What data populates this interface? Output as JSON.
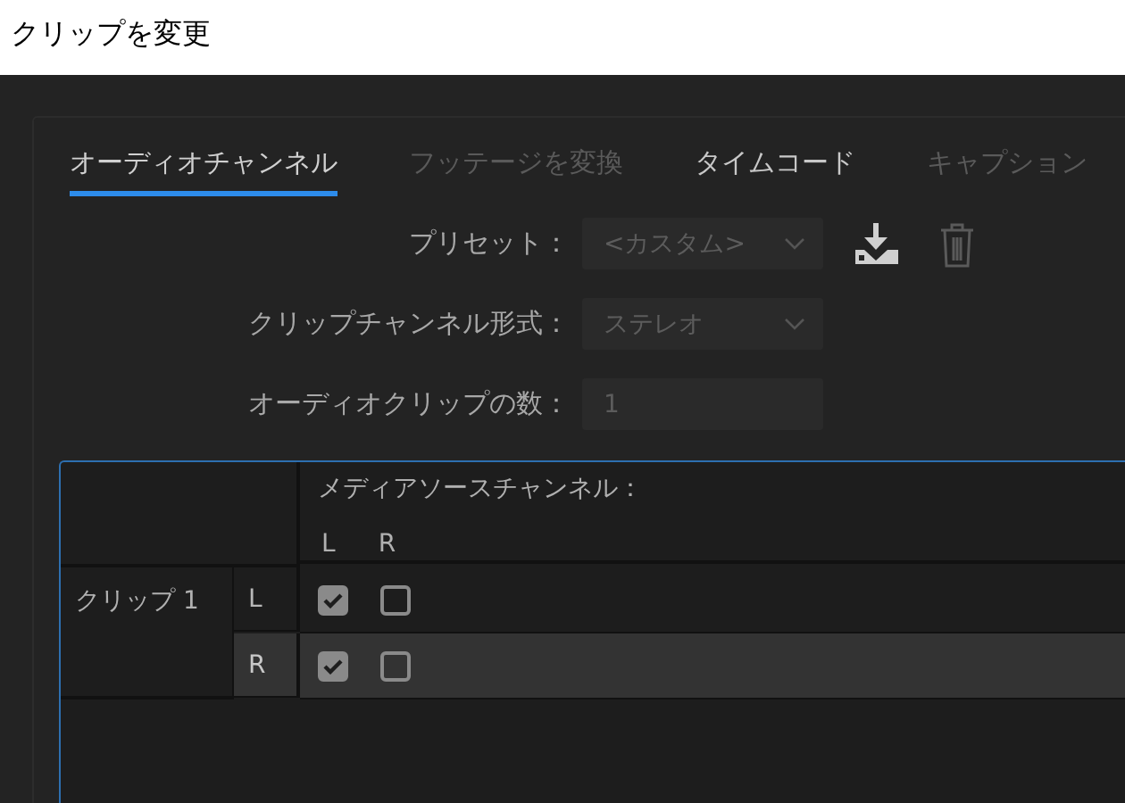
{
  "window": {
    "title": "クリップを変更"
  },
  "tabs": [
    {
      "label": "オーディオチャンネル",
      "selected": true,
      "disabled": false
    },
    {
      "label": "フッテージを変換",
      "selected": false,
      "disabled": true
    },
    {
      "label": "タイムコード",
      "selected": false,
      "disabled": false
    },
    {
      "label": "キャプション",
      "selected": false,
      "disabled": true
    }
  ],
  "form": [
    {
      "label": "プリセット：",
      "kind": "dropdown",
      "value": "<カスタム>"
    },
    {
      "label": "クリップチャンネル形式：",
      "kind": "dropdown",
      "value": "ステレオ"
    },
    {
      "label": "オーディオクリップの数：",
      "kind": "number",
      "value": "1"
    }
  ],
  "table": {
    "header": "メディアソースチャンネル：",
    "source_channels": [
      "L",
      "R"
    ],
    "clip_label": "クリップ 1",
    "rows": [
      {
        "channel": "L",
        "selected": false,
        "checks": [
          true,
          false
        ]
      },
      {
        "channel": "R",
        "selected": true,
        "checks": [
          true,
          false
        ]
      }
    ]
  }
}
